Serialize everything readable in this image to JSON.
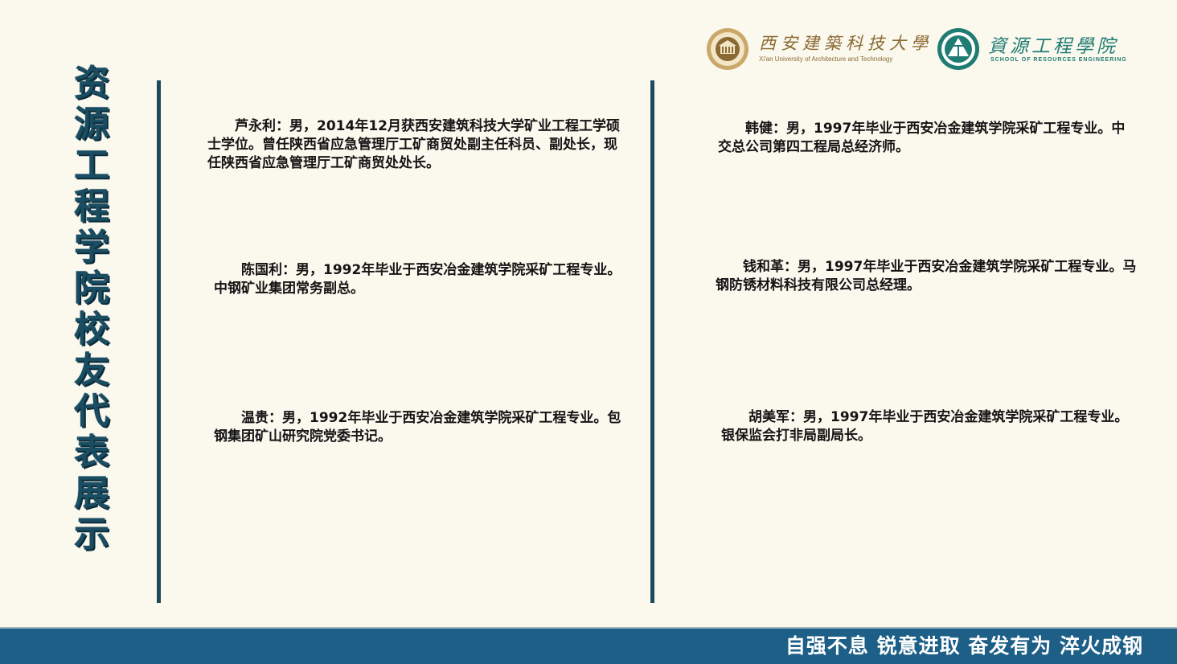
{
  "title": {
    "chars": [
      "资",
      "源",
      "工",
      "程",
      "学",
      "院",
      "校",
      "友",
      "代",
      "表",
      "展",
      "示"
    ]
  },
  "header": {
    "university_name": "西安建築科技大學",
    "university_name_en": "Xi'an University of Architecture and Technology",
    "school_name": "資源工程學院",
    "school_name_en": "SCHOOL OF RESOURCES ENGINEERING"
  },
  "profiles": [
    {
      "text": "芦永利：男，2014年12月获西安建筑科技大学矿业工程工学硕士学位。曾任陕西省应急管理厅工矿商贸处副主任科员、副处长，现任陕西省应急管理厅工矿商贸处处长。"
    },
    {
      "text": "陈国利：男，1992年毕业于西安冶金建筑学院采矿工程专业。中钢矿业集团常务副总。"
    },
    {
      "text": "温贵：男，1992年毕业于西安冶金建筑学院采矿工程专业。包钢集团矿山研究院党委书记。"
    },
    {
      "text": "韩健：男，1997年毕业于西安冶金建筑学院采矿工程专业。中交总公司第四工程局总经济师。"
    },
    {
      "text": "钱和革：男，1997年毕业于西安冶金建筑学院采矿工程专业。马钢防锈材料科技有限公司总经理。"
    },
    {
      "text": "胡美军：男，1997年毕业于西安冶金建筑学院采矿工程专业。银保监会打非局副局长。"
    }
  ],
  "footer": {
    "slogan": "自强不息 锐意进取 奋发有为 淬火成钢"
  },
  "colors": {
    "background": "#fbf8ee",
    "title": "#1a4d62",
    "divider": "#1e4a5e",
    "footer": "#1d5f87",
    "university_gold": "#8a6a32",
    "school_green": "#1f7c73"
  }
}
